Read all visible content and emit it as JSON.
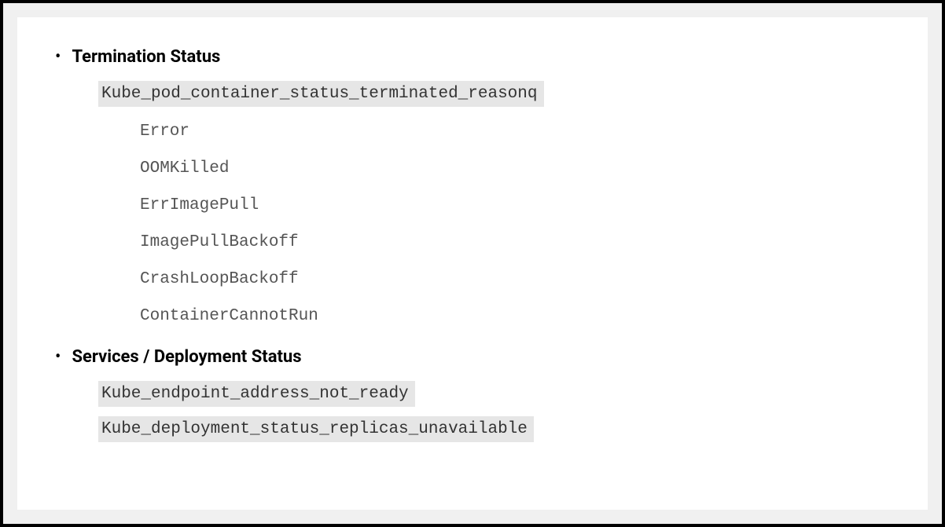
{
  "sections": [
    {
      "heading": "Termination Status",
      "metrics": [
        "Kube_pod_container_status_terminated_reasonq"
      ],
      "reasons": [
        "Error",
        "OOMKilled",
        "ErrImagePull",
        "ImagePullBackoff",
        "CrashLoopBackoff",
        "ContainerCannotRun"
      ]
    },
    {
      "heading": "Services / Deployment Status",
      "metrics": [
        "Kube_endpoint_address_not_ready",
        "Kube_deployment_status_replicas_unavailable"
      ],
      "reasons": []
    }
  ]
}
